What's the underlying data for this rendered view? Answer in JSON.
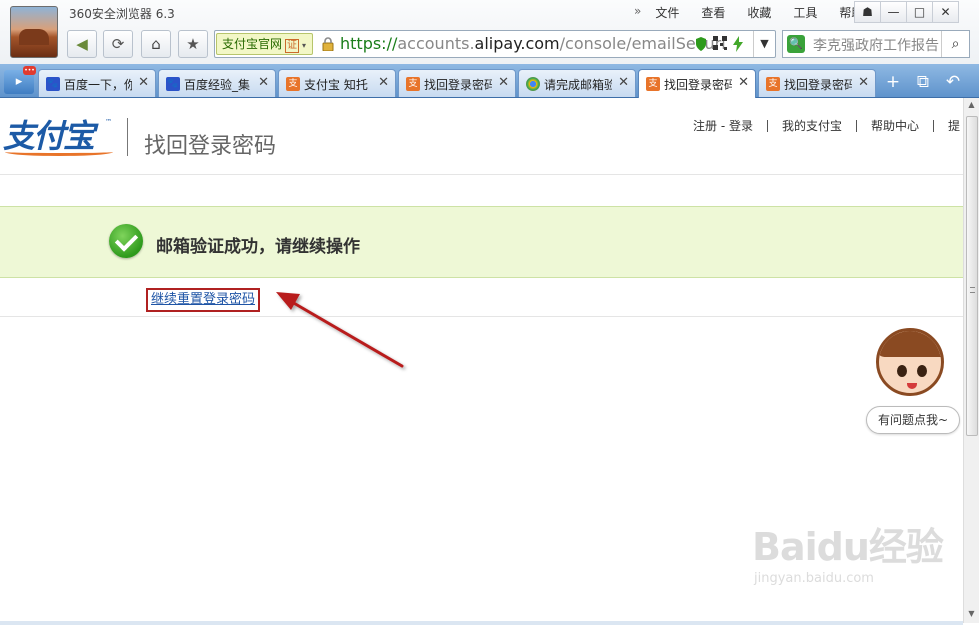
{
  "browser": {
    "title": "360安全浏览器 6.3",
    "menu": [
      "文件",
      "查看",
      "收藏",
      "工具",
      "帮助"
    ],
    "more": "»",
    "window_buttons": [
      "☗",
      "—",
      "□",
      "✕"
    ],
    "cert_label": "支付宝官网",
    "cert_badge": "证",
    "url_scheme": "https://",
    "url_sub": "accounts.",
    "url_host": "alipay.com",
    "url_path": "/console/emailSecuri",
    "search_text": "李克强政府工作报告"
  },
  "tabs": [
    {
      "label": "百度一下，你",
      "icon": "baidu-icon",
      "active": false
    },
    {
      "label": "百度经验_集",
      "icon": "baidu-icon",
      "active": false
    },
    {
      "label": "支付宝 知托",
      "icon": "alipay-icon",
      "active": false
    },
    {
      "label": "找回登录密码",
      "icon": "alipay-icon",
      "active": false
    },
    {
      "label": "请完成邮箱验",
      "icon": "chrome-icon",
      "active": false
    },
    {
      "label": "找回登录密码",
      "icon": "alipay-icon",
      "active": true
    },
    {
      "label": "找回登录密码",
      "icon": "alipay-icon",
      "active": false
    }
  ],
  "page": {
    "logo_text": "支付宝",
    "logo_tm": "™",
    "title": "找回登录密码",
    "topnav": [
      "注册 - 登录",
      "我的支付宝",
      "帮助中心",
      "提"
    ],
    "success_message": "邮箱验证成功，请继续操作",
    "continue_link": "继续重置登录密码",
    "helper_text": "有问题点我~"
  },
  "watermark": {
    "main": "Baidu经验",
    "sub": "jingyan.baidu.com"
  },
  "colors": {
    "tabbar": "#6f9fd6",
    "success_bg": "#eef8d6",
    "link": "#1f55a6",
    "highlight_border": "#b02121",
    "brand_blue": "#1c5aa6",
    "brand_orange": "#e8742a"
  }
}
